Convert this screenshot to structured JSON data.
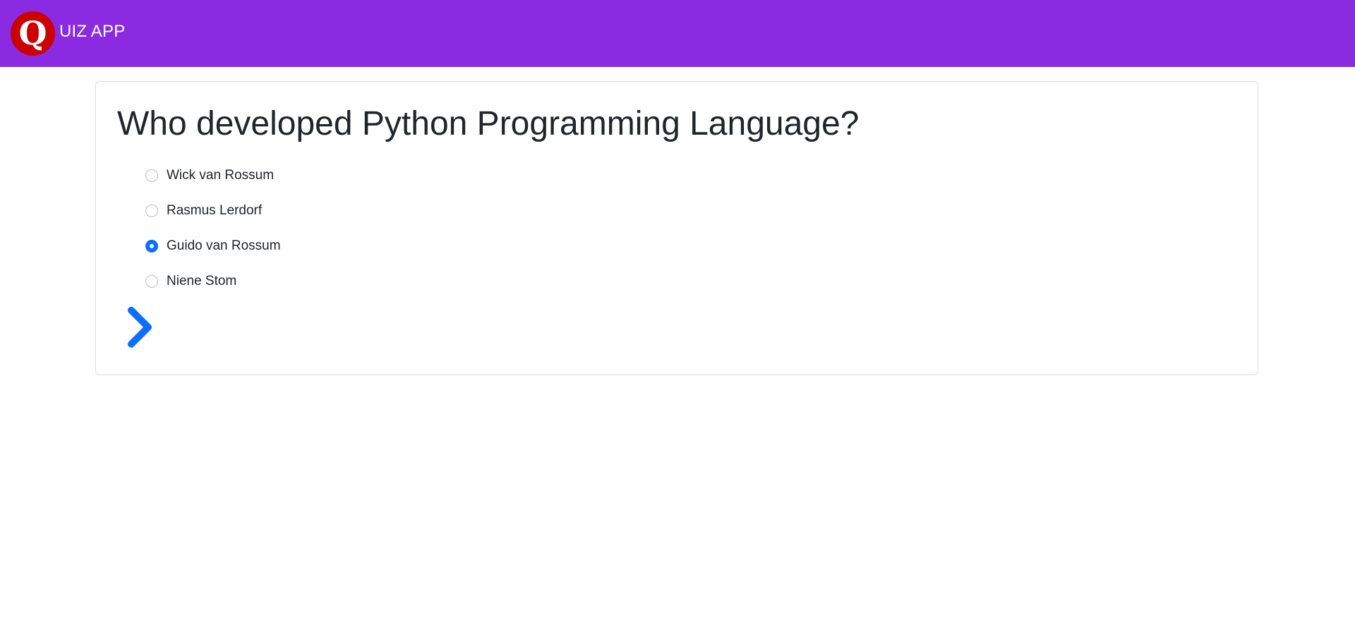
{
  "navbar": {
    "logo_letter": "Q",
    "brand": "UIZ APP",
    "background_color": "#8a2be2",
    "logo_color": "#cc0000"
  },
  "quiz": {
    "question": "Who developed Python Programming Language?",
    "options": [
      {
        "label": "Wick van Rossum",
        "selected": false
      },
      {
        "label": "Rasmus Lerdorf",
        "selected": false
      },
      {
        "label": "Guido van Rossum",
        "selected": true
      },
      {
        "label": "Niene Stom",
        "selected": false
      }
    ],
    "next_icon": "chevron-right-icon",
    "accent_color": "#0d6efd"
  }
}
